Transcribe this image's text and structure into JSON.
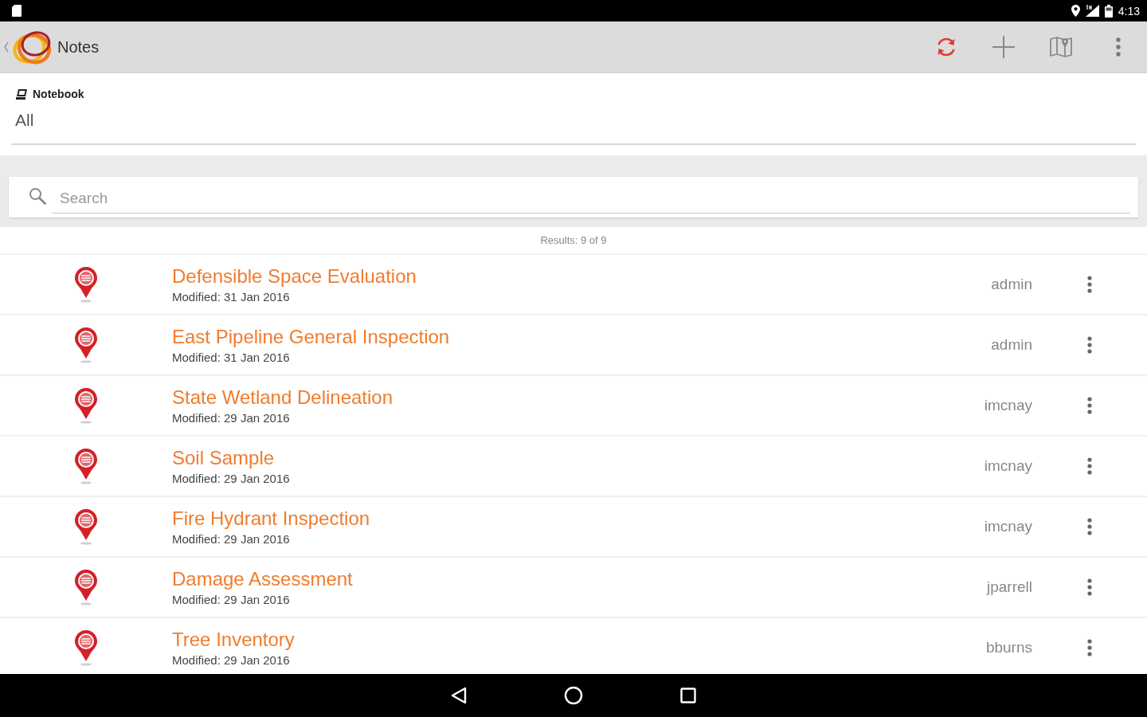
{
  "status_bar": {
    "time": "4:13"
  },
  "app_bar": {
    "title": "Notes"
  },
  "notebook": {
    "label": "Notebook",
    "value": "All"
  },
  "search": {
    "placeholder": "Search"
  },
  "results": "Results: 9 of 9",
  "notes": [
    {
      "title": "Defensible Space Evaluation",
      "modified": "Modified: 31 Jan 2016",
      "author": "admin"
    },
    {
      "title": "East Pipeline General Inspection",
      "modified": "Modified: 31 Jan 2016",
      "author": "admin"
    },
    {
      "title": "State Wetland Delineation",
      "modified": "Modified: 29 Jan 2016",
      "author": "imcnay"
    },
    {
      "title": "Soil Sample",
      "modified": "Modified: 29 Jan 2016",
      "author": "imcnay"
    },
    {
      "title": "Fire Hydrant Inspection",
      "modified": "Modified: 29 Jan 2016",
      "author": "imcnay"
    },
    {
      "title": "Damage Assessment",
      "modified": "Modified: 29 Jan 2016",
      "author": "jparrell"
    },
    {
      "title": "Tree Inventory",
      "modified": "Modified: 29 Jan 2016",
      "author": "bburns"
    }
  ]
}
